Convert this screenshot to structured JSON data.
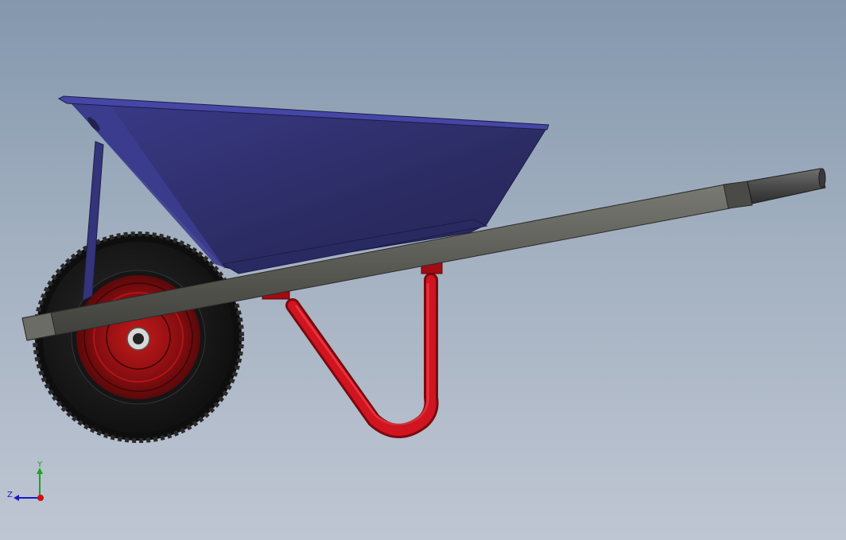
{
  "viewport": {
    "background_top": "#8497ad",
    "background_bottom": "#bfc6d3"
  },
  "model": {
    "tray_color": "#2e2e6b",
    "frame_color": "#5a5a55",
    "leg_color": "#c0101a",
    "wheel_rim_color": "#8a0f12",
    "tire_color": "#1c1c1c"
  },
  "triad": {
    "y_label": "Y",
    "z_label": "Z",
    "y_color": "#1aa51a",
    "z_color": "#1a1ac8",
    "x_color": "#d01010"
  }
}
